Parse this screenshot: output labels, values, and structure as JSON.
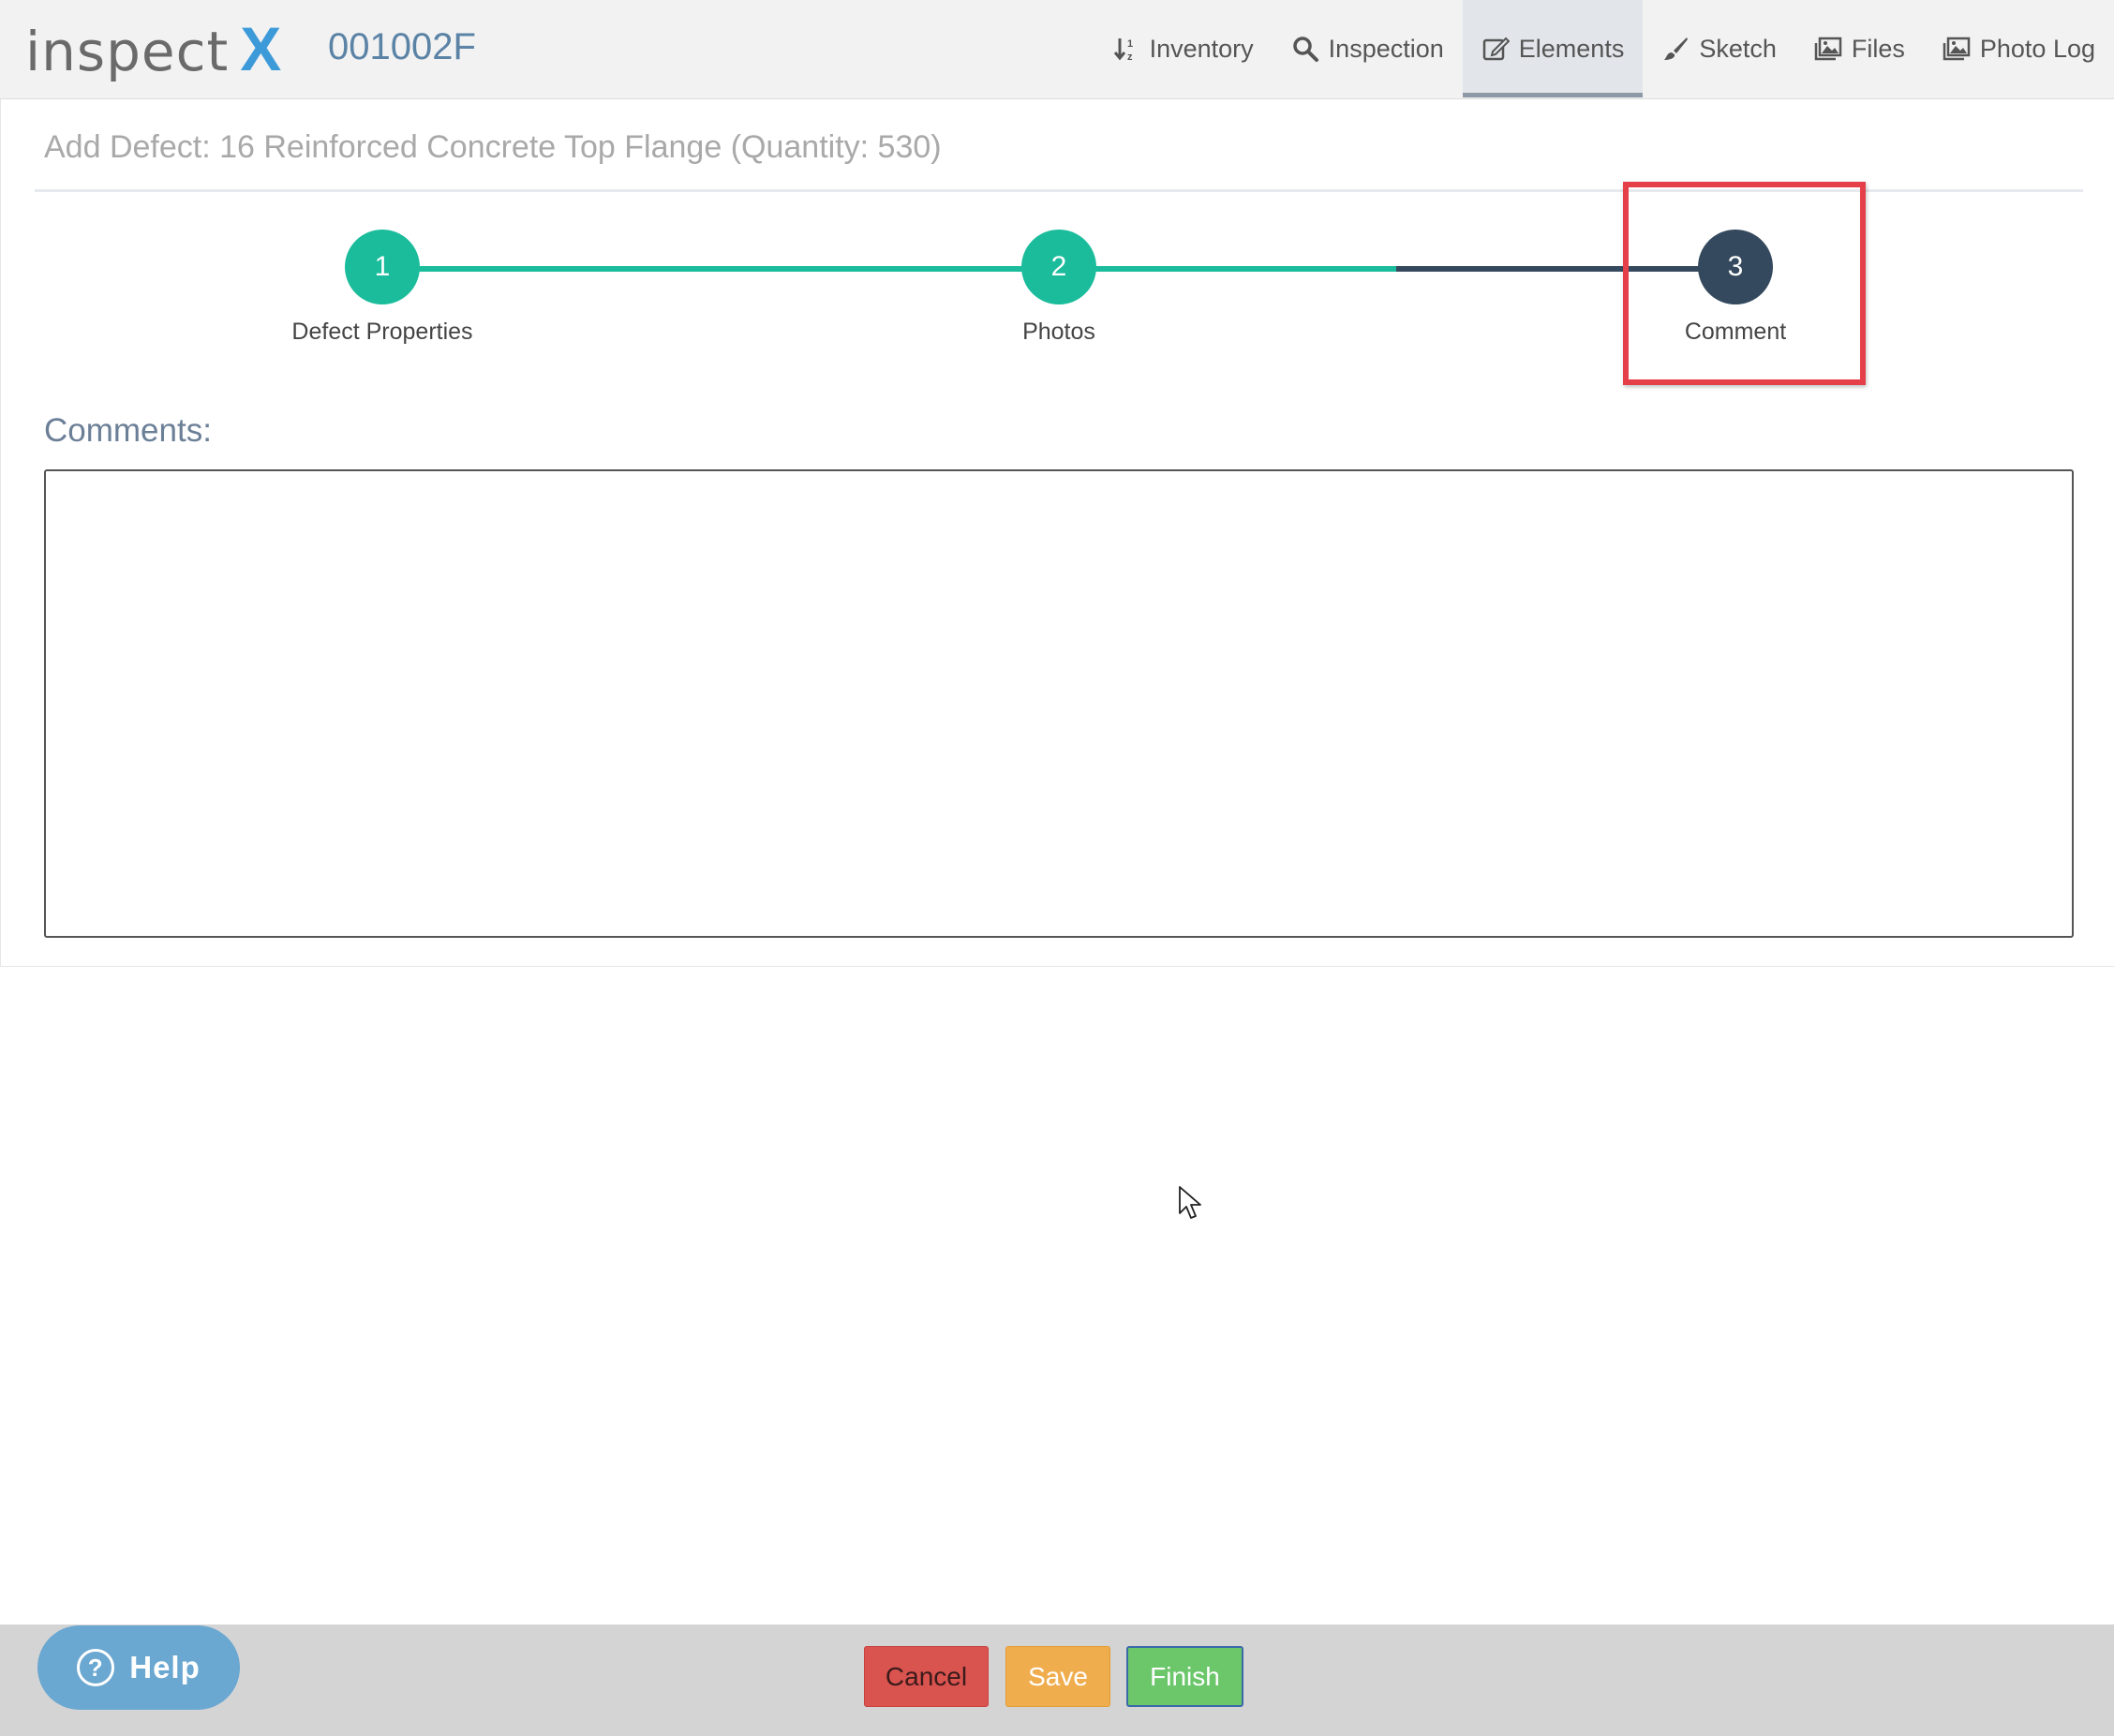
{
  "header": {
    "logo_text": "inspect",
    "logo_x": "X",
    "structure_id": "001002F",
    "nav": [
      {
        "label": "Inventory",
        "icon": "sort-icon"
      },
      {
        "label": "Inspection",
        "icon": "search-icon"
      },
      {
        "label": "Elements",
        "icon": "edit-icon",
        "active": true
      },
      {
        "label": "Sketch",
        "icon": "brush-icon"
      },
      {
        "label": "Files",
        "icon": "images-icon"
      },
      {
        "label": "Photo Log",
        "icon": "images-icon"
      }
    ]
  },
  "panel": {
    "title": "Add Defect: 16 Reinforced Concrete Top Flange (Quantity: 530)",
    "steps": [
      {
        "number": "1",
        "label": "Defect Properties",
        "state": "complete"
      },
      {
        "number": "2",
        "label": "Photos",
        "state": "complete"
      },
      {
        "number": "3",
        "label": "Comment",
        "state": "current"
      }
    ],
    "comments_label": "Comments:",
    "comments_value": ""
  },
  "footer": {
    "help_label": "Help",
    "cancel_label": "Cancel",
    "save_label": "Save",
    "finish_label": "Finish"
  },
  "colors": {
    "step_complete": "#1abc9c",
    "step_current": "#34495e",
    "highlight": "#e5404a",
    "cancel": "#d9534f",
    "save": "#f0ad4e",
    "finish": "#6cc76b",
    "help": "#6aa7d1"
  }
}
